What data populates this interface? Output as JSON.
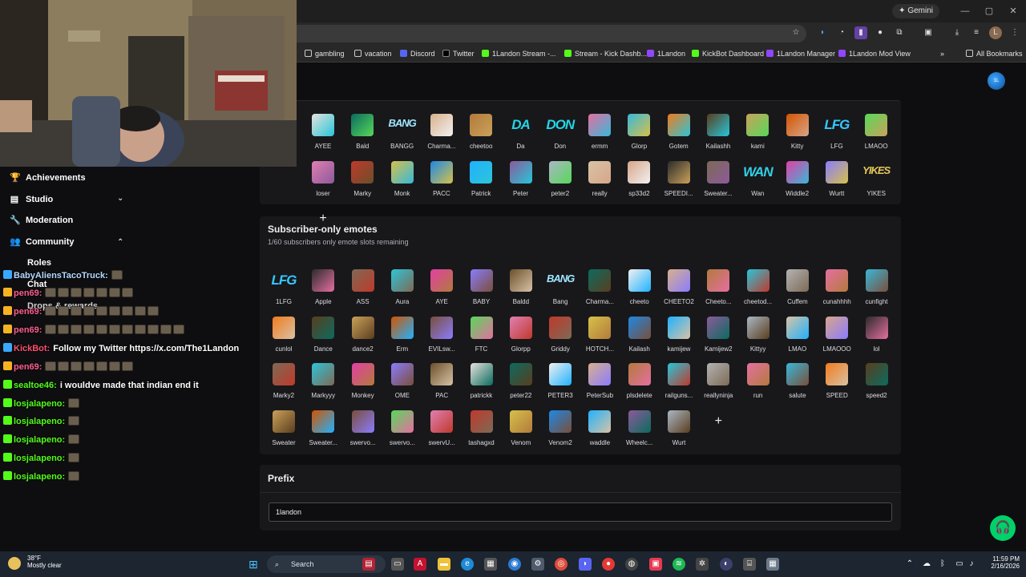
{
  "browser": {
    "gemini_label": "Gemini",
    "bookmarks": [
      "gambling",
      "vacation",
      "Discord",
      "Twitter",
      "1Landon Stream -...",
      "Stream - Kick Dashb...",
      "1Landon",
      "KickBot Dashboard",
      "1Landon Manager",
      "1Landon Mod View"
    ],
    "all_bookmarks": "All Bookmarks",
    "more": "»"
  },
  "emotes_top": [
    "AYEE",
    "Bald",
    "BANGG",
    "Charma...",
    "cheetoo",
    "Da",
    "Don",
    "ermm",
    "Glorp",
    "Gotem",
    "Kailashh",
    "kami",
    "Kitty",
    "LFG",
    "LMAOO",
    "loser",
    "Marky",
    "Monk",
    "PACC",
    "Patrick",
    "Peter",
    "peter2",
    "really",
    "sp33d2",
    "SPEEDI...",
    "Sweater...",
    "Wan",
    "Widdle2",
    "Wurtt",
    "YIKES"
  ],
  "subscriber": {
    "title": "Subscriber-only emotes",
    "subtitle": "1/60 subscribers only emote slots remaining",
    "emotes": [
      "1LFG",
      "Apple",
      "ASS",
      "Aura",
      "AYE",
      "BABY",
      "Baldd",
      "Bang",
      "Charma...",
      "cheeto",
      "CHEETO2",
      "Cheeto...",
      "cheetod...",
      "Cuffem",
      "cunahhhh",
      "cunfight",
      "cunlol",
      "Dance",
      "dance2",
      "Erm",
      "EVILsw...",
      "FTC",
      "Glorpp",
      "Griddy",
      "HOTCH...",
      "Kailash",
      "kamijew",
      "Kamijew2",
      "Kittyy",
      "LMAO",
      "LMAOOO",
      "lol",
      "Marky2",
      "Markyyy",
      "Monkey",
      "OME",
      "PAC",
      "patrickk",
      "peter22",
      "PETER3",
      "PeterSub",
      "plsdelete",
      "railguns...",
      "reallyninja",
      "run",
      "salute",
      "SPEED",
      "speed2",
      "Sweater",
      "Sweater...",
      "swervo...",
      "swervo...",
      "swervU...",
      "tashagxd",
      "Venom",
      "Venom2",
      "waddle",
      "Wheelc...",
      "Wurt"
    ]
  },
  "prefix": {
    "title": "Prefix",
    "value": "1landon"
  },
  "add_label": "+",
  "sidebar": {
    "items": [
      {
        "label": "Achievements",
        "icon": "trophy-icon"
      },
      {
        "label": "Studio",
        "icon": "studio-icon"
      },
      {
        "label": "Moderation",
        "icon": "wrench-icon"
      },
      {
        "label": "Community",
        "icon": "community-icon"
      },
      {
        "label": "Roles"
      },
      {
        "label": "Chat"
      },
      {
        "label": "Drops & rewards"
      }
    ]
  },
  "chat": [
    {
      "user": "BabyAliensTacoTruck:",
      "text": "",
      "color": "#b5d8ff"
    },
    {
      "user": "pen69:",
      "text": "",
      "color": "#ff5d8f"
    },
    {
      "user": "pen69:",
      "text": "",
      "color": "#ff5d8f"
    },
    {
      "user": "pen69:",
      "text": "",
      "color": "#ff5d8f"
    },
    {
      "user": "KickBot:",
      "text": "Follow my Twitter https://x.com/The1Landon",
      "color": "#ff4f6e"
    },
    {
      "user": "pen69:",
      "text": "",
      "color": "#ff5d8f"
    },
    {
      "user": "sealtoe46:",
      "text": "i wouldve made that indian end it",
      "color": "#53fc18"
    },
    {
      "user": "losjalapeno:",
      "text": "",
      "color": "#53fc18"
    },
    {
      "user": "losjalapeno:",
      "text": "",
      "color": "#53fc18"
    },
    {
      "user": "losjalapeno:",
      "text": "",
      "color": "#53fc18"
    },
    {
      "user": "losjalapeno:",
      "text": "",
      "color": "#53fc18"
    },
    {
      "user": "losjalapeno:",
      "text": "",
      "color": "#53fc18"
    }
  ],
  "taskbar": {
    "temp": "38°F",
    "weather": "Mostly clear",
    "search": "Search",
    "time": "11:59 PM",
    "date": "2/16/2026"
  },
  "colors": {
    "accent": "#53fc18",
    "panel": "#18181b",
    "bg": "#0e0e10"
  }
}
